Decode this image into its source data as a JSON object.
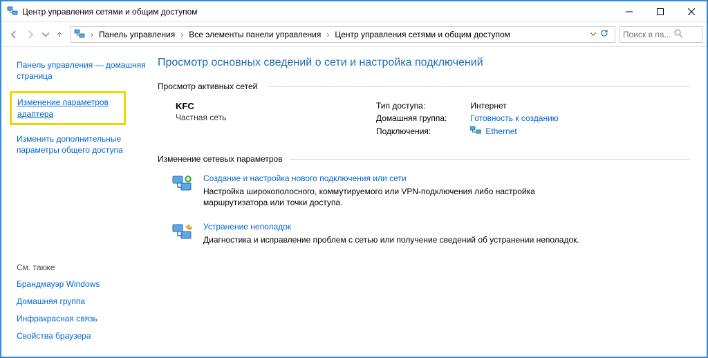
{
  "window": {
    "title": "Центр управления сетями и общим доступом"
  },
  "breadcrumb": {
    "items": [
      "Панель управления",
      "Все элементы панели управления",
      "Центр управления сетями и общим доступом"
    ]
  },
  "search": {
    "placeholder": "Поиск в па..."
  },
  "sidebar": {
    "home_link": "Панель управления — домашняя страница",
    "adapter_link": "Изменение параметров адаптера",
    "sharing_link": "Изменить дополнительные параметры общего доступа",
    "see_also_header": "См. также",
    "see_also": [
      "Брандмауэр Windows",
      "Домашняя группа",
      "Инфракрасная связь",
      "Свойства браузера"
    ]
  },
  "main": {
    "heading": "Просмотр основных сведений о сети и настройка подключений",
    "active_header": "Просмотр активных сетей",
    "network": {
      "name": "KFC",
      "category": "Частная сеть",
      "access_label": "Тип доступа:",
      "access_value": "Интернет",
      "homegroup_label": "Домашняя группа:",
      "homegroup_value": "Готовность к созданию",
      "connections_label": "Подключения:",
      "connections_value": "Ethernet"
    },
    "change_header": "Изменение сетевых параметров",
    "option_new": {
      "title": "Создание и настройка нового подключения или сети",
      "desc": "Настройка широкополосного, коммутируемого или VPN-подключения либо настройка маршрутизатора или точки доступа."
    },
    "option_troubleshoot": {
      "title": "Устранение неполадок",
      "desc": "Диагностика и исправление проблем с сетью или получение сведений об устранении неполадок."
    }
  }
}
